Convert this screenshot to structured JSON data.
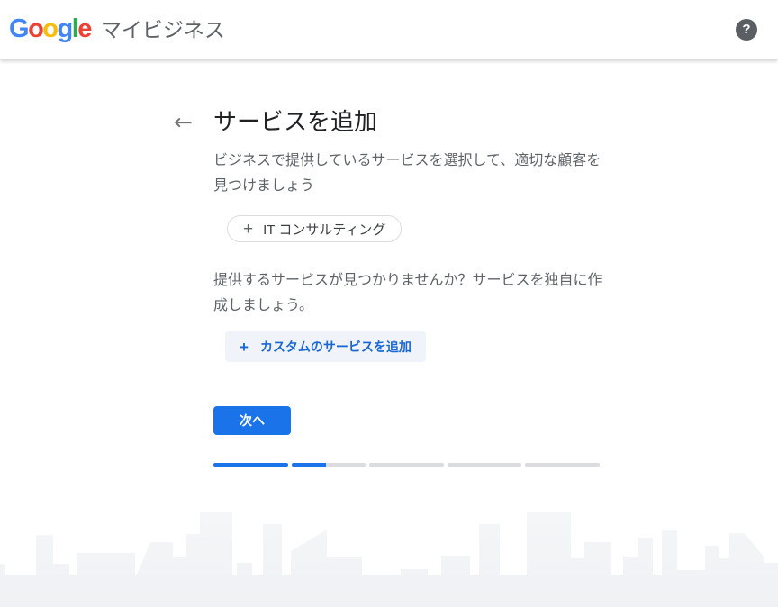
{
  "header": {
    "logo": {
      "letters": [
        {
          "ch": "G",
          "color": "#4285F4"
        },
        {
          "ch": "o",
          "color": "#EA4335"
        },
        {
          "ch": "o",
          "color": "#FBBC05"
        },
        {
          "ch": "g",
          "color": "#4285F4"
        },
        {
          "ch": "l",
          "color": "#34A853"
        },
        {
          "ch": "e",
          "color": "#EA4335"
        }
      ]
    },
    "product_name": "マイビジネス",
    "help_glyph": "?"
  },
  "main": {
    "back_glyph": "←",
    "title": "サービスを追加",
    "subtitle": "ビジネスで提供しているサービスを選択して、適切な顧客を見つけましょう",
    "service_chip": {
      "plus": "+",
      "label": "IT コンサルティング"
    },
    "not_found_text": "提供するサービスが見つかりませんか？サービスを独自に作成しましょう。",
    "custom_service": {
      "plus": "+",
      "label": "カスタムのサービスを追加"
    },
    "next_button_label": "次へ",
    "progress": {
      "segments": [
        1,
        0.47,
        0,
        0,
        0
      ]
    }
  },
  "colors": {
    "accent-blue": "#1a73e8",
    "link-blue": "#1967d2",
    "link-bg": "#f0f3f9",
    "text-primary": "#202124",
    "text-secondary": "#5f6368",
    "chip-border": "#dadce0",
    "track-gray": "#dadce0",
    "header-gray": "#5f6368"
  }
}
